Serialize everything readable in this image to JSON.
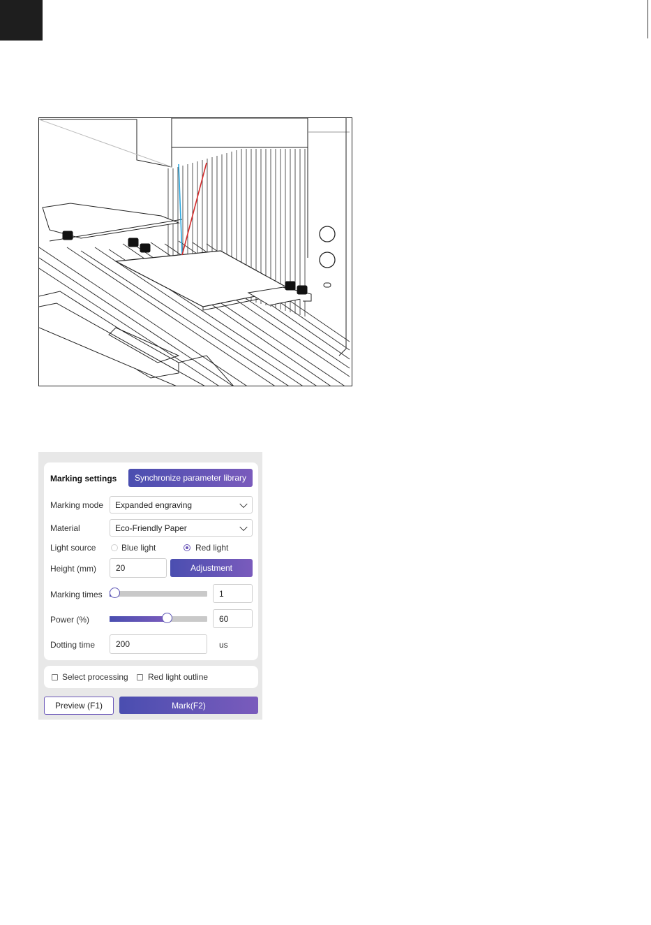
{
  "panel": {
    "title": "Marking settings",
    "sync_button": "Synchronize parameter library",
    "marking_mode": {
      "label": "Marking mode",
      "value": "Expanded engraving"
    },
    "material": {
      "label": "Material",
      "value": "Eco-Friendly Paper"
    },
    "light_source": {
      "label": "Light source",
      "options": [
        "Blue light",
        "Red light"
      ],
      "selected": "Red light"
    },
    "height": {
      "label": "Height (mm)",
      "value": "20",
      "button": "Adjustment"
    },
    "marking_times": {
      "label": "Marking times",
      "value": "1",
      "slider_fraction": 0.0
    },
    "power": {
      "label": "Power (%)",
      "value": "60",
      "slider_fraction": 0.6
    },
    "dotting_time": {
      "label": "Dotting time",
      "value": "200",
      "unit": "us"
    },
    "options": {
      "select_processing": "Select processing",
      "red_light_outline": "Red light outline"
    },
    "preview_button": "Preview (F1)",
    "mark_button": "Mark(F2)"
  },
  "colors": {
    "accent_start": "#4a4eb0",
    "accent_end": "#7a5bbc",
    "blue_beam": "#2aa7e0",
    "red_beam": "#d42a2a"
  }
}
